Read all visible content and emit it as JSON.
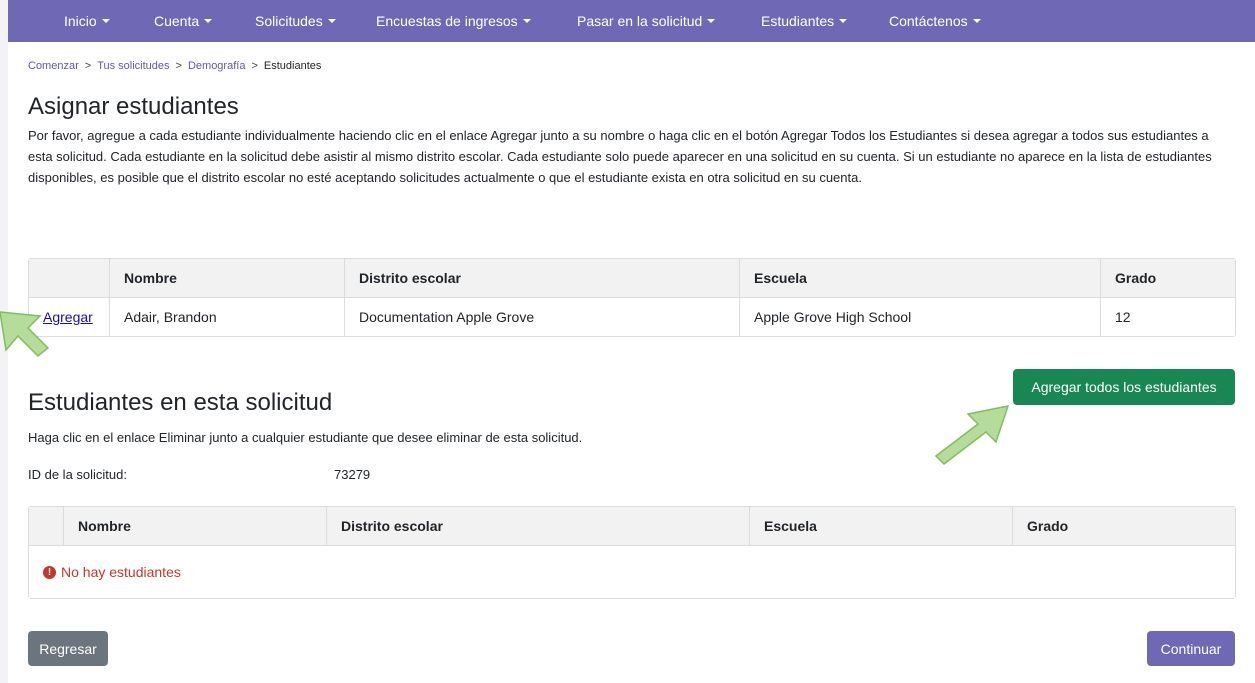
{
  "nav": {
    "items": [
      {
        "label": "Inicio"
      },
      {
        "label": "Cuenta"
      },
      {
        "label": "Solicitudes"
      },
      {
        "label": "Encuestas de ingresos"
      },
      {
        "label": "Pasar en la solicitud"
      },
      {
        "label": "Estudiantes"
      },
      {
        "label": "Contáctenos"
      }
    ]
  },
  "breadcrumb": {
    "items": [
      "Comenzar",
      "Tus solicitudes",
      "Demografía",
      "Estudiantes"
    ],
    "separator": ">"
  },
  "assign": {
    "title": "Asignar estudiantes",
    "description": "Por favor, agregue a cada estudiante individualmente haciendo clic en el enlace Agregar junto a su nombre o haga clic en el botón Agregar Todos los Estudiantes si desea agregar a todos sus estudiantes a esta solicitud. Cada estudiante en la solicitud debe asistir al mismo distrito escolar. Cada estudiante solo puede aparecer en una solicitud en su cuenta. Si un estudiante no aparece en la lista de estudiantes disponibles, es posible que el distrito escolar no esté aceptando solicitudes actualmente o que el estudiante exista en otra solicitud en su cuenta.",
    "columns": [
      "",
      "Nombre",
      "Distrito escolar",
      "Escuela",
      "Grado"
    ],
    "rows": [
      {
        "action": "Agregar",
        "name": "Adair, Brandon",
        "district": "Documentation Apple Grove",
        "school": "Apple Grove High School",
        "grade": "12"
      }
    ],
    "add_all_label": "Agregar todos los estudiantes"
  },
  "on_app": {
    "title": "Estudiantes en esta solicitud",
    "description": "Haga clic en el enlace Eliminar junto a cualquier estudiante que desee eliminar de esta solicitud.",
    "id_label": "ID de la solicitud:",
    "id_value": "73279",
    "columns": [
      "",
      "Nombre",
      "Distrito escolar",
      "Escuela",
      "Grado"
    ],
    "empty_message": "No hay estudiantes"
  },
  "footer": {
    "back_label": "Regresar",
    "continue_label": "Continuar"
  },
  "colors": {
    "nav_bg": "#6f68b4",
    "add_all_bg": "#198754",
    "back_bg": "#6c757d",
    "continue_bg": "#6f68b4",
    "error": "#c0392b",
    "arrow_fill": "#b5dc9a",
    "arrow_stroke": "#7fbf5e"
  }
}
